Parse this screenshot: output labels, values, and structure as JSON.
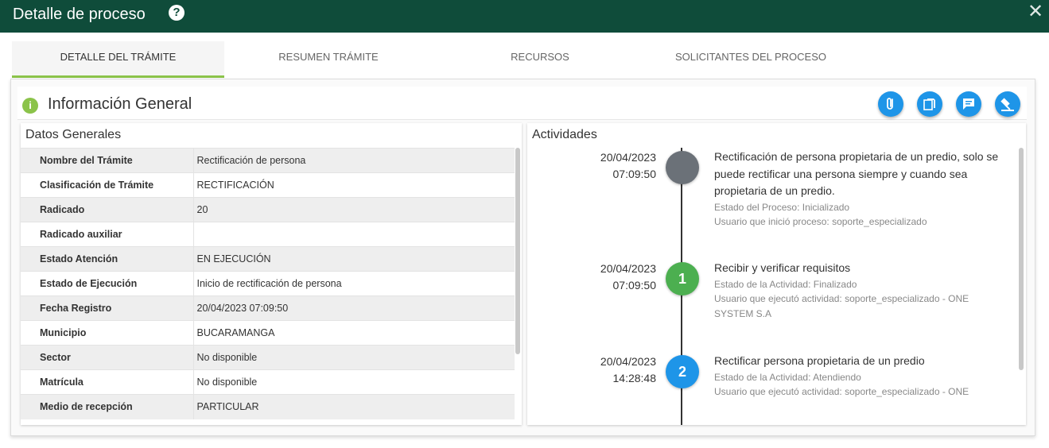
{
  "window": {
    "title": "Detalle de proceso",
    "help_icon": "question-icon",
    "close_icon": "close-icon"
  },
  "tabs": [
    {
      "label": "DETALLE DEL TRÁMITE",
      "active": true
    },
    {
      "label": "RESUMEN TRÁMITE",
      "active": false
    },
    {
      "label": "RECURSOS",
      "active": false
    },
    {
      "label": "SOLICITANTES DEL PROCESO",
      "active": false
    }
  ],
  "info": {
    "title": "Información General",
    "actions": [
      "attach-icon",
      "copy-icon",
      "comment-icon",
      "gavel-icon"
    ]
  },
  "datos": {
    "title": "Datos Generales",
    "rows": [
      {
        "label": "Nombre del Trámite",
        "value": "Rectificación de persona"
      },
      {
        "label": "Clasificación de Trámite",
        "value": "RECTIFICACIÓN"
      },
      {
        "label": "Radicado",
        "value": "20"
      },
      {
        "label": "Radicado auxiliar",
        "value": ""
      },
      {
        "label": "Estado Atención",
        "value": "EN EJECUCIÓN"
      },
      {
        "label": "Estado de Ejecución",
        "value": "Inicio de rectificación de persona"
      },
      {
        "label": "Fecha Registro",
        "value": "20/04/2023 07:09:50"
      },
      {
        "label": "Municipio",
        "value": "BUCARAMANGA"
      },
      {
        "label": "Sector",
        "value": "No disponible"
      },
      {
        "label": "Matrícula",
        "value": "No disponible"
      },
      {
        "label": "Medio de recepción",
        "value": "PARTICULAR"
      }
    ]
  },
  "actividades": {
    "title": "Actividades",
    "items": [
      {
        "date": "20/04/2023",
        "time": "07:09:50",
        "marker": "",
        "color": "#6b7178",
        "title": "Rectificación de persona propietaria de un predio, solo se puede rectificar una persona siempre y cuando sea propietaria de un predio.",
        "estado": "Estado del Proceso: Inicializado",
        "usuario": "Usuario que inició proceso: soporte_especializado"
      },
      {
        "date": "20/04/2023",
        "time": "07:09:50",
        "marker": "1",
        "color": "#4caf50",
        "title": "Recibir y verificar requisitos",
        "estado": "Estado de la Actividad: Finalizado",
        "usuario": "Usuario que ejecutó actividad: soporte_especializado - ONE SYSTEM S.A"
      },
      {
        "date": "20/04/2023",
        "time": "14:28:48",
        "marker": "2",
        "color": "#1e95e8",
        "title": "Rectificar persona propietaria de un predio",
        "estado": "Estado de la Actividad: Atendiendo",
        "usuario": "Usuario que ejecutó actividad: soporte_especializado - ONE"
      }
    ]
  }
}
